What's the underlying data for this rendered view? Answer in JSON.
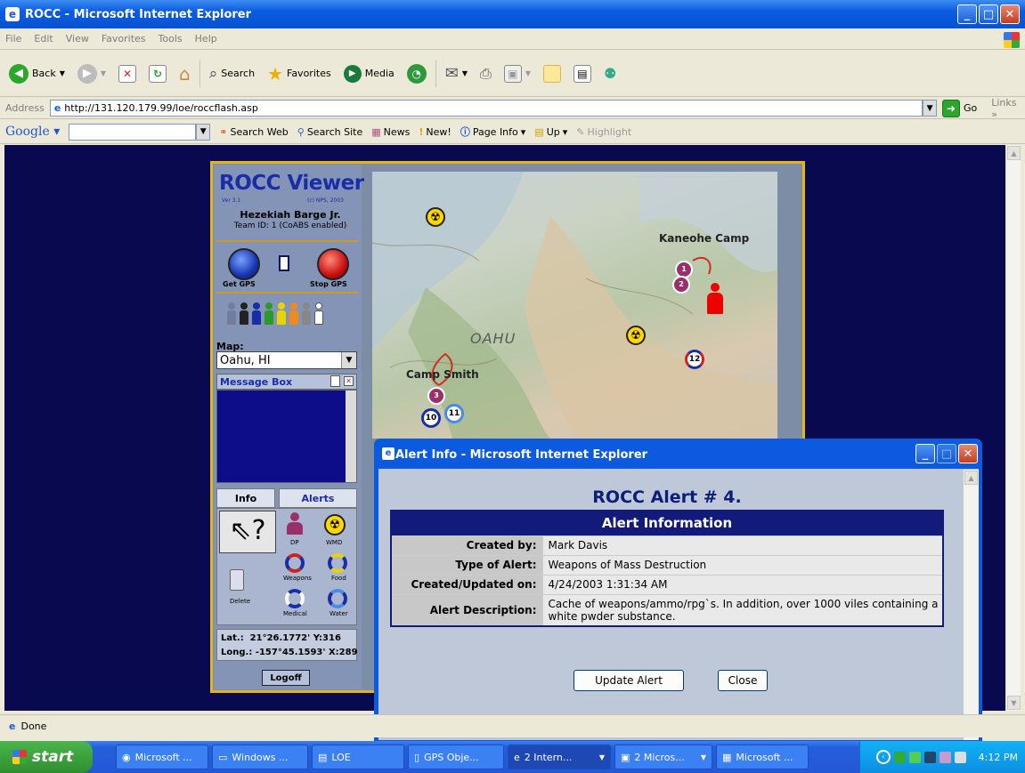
{
  "window": {
    "title": "ROCC - Microsoft Internet Explorer"
  },
  "menu": [
    "File",
    "Edit",
    "View",
    "Favorites",
    "Tools",
    "Help"
  ],
  "toolbar": {
    "back": "Back",
    "search": "Search",
    "favorites": "Favorites",
    "media": "Media"
  },
  "address": {
    "label": "Address",
    "url": "http://131.120.179.99/loe/roccflash.asp",
    "go": "Go",
    "links": "Links"
  },
  "google": {
    "brand": "Google",
    "items": [
      "Search Web",
      "Search Site",
      "News",
      "New!",
      "Page Info",
      "Up",
      "Highlight"
    ]
  },
  "viewer": {
    "logo": "ROCC Viewer",
    "version": "Ver 3.1",
    "copyright": "(c) NPS, 2003",
    "user": "Hezekiah Barge Jr.",
    "team": "Team ID: 1   (CoABS enabled)",
    "get_gps": "Get GPS",
    "stop_gps": "Stop GPS",
    "map_label": "Map:",
    "map_value": "Oahu, HI",
    "message_box": "Message Box",
    "tabs": {
      "info": "Info",
      "alerts": "Alerts"
    },
    "palette": {
      "dp": "DP",
      "wmd": "WMD",
      "weapons": "Weapons",
      "food": "Food",
      "delete": "Delete",
      "medical": "Medical",
      "water": "Water"
    },
    "lat_label": "Lat.:",
    "lat_value": "21°26.1772'",
    "y_label": "Y:316",
    "long_label": "Long.:",
    "long_value": "-157°45.1593'",
    "x_label": "X:289",
    "logoff": "Logoff"
  },
  "map": {
    "labels": {
      "kaneohe": "Kaneohe Camp",
      "oahu": "OAHU",
      "camp_smith": "Camp Smith"
    },
    "markers": [
      "1",
      "2",
      "3",
      "10",
      "11",
      "12"
    ]
  },
  "alert": {
    "window_title": "Alert Info - Microsoft Internet Explorer",
    "heading": "ROCC Alert # 4.",
    "table_header": "Alert Information",
    "rows": [
      {
        "key": "Created by:",
        "value": "Mark Davis"
      },
      {
        "key": "Type of Alert:",
        "value": "Weapons of Mass Destruction"
      },
      {
        "key": "Created/Updated on:",
        "value": "4/24/2003 1:31:34 AM"
      },
      {
        "key": "Alert Description:",
        "value": "Cache of weapons/ammo/rpg`s. In addition, over 1000 viles containing a white pwder substance."
      }
    ],
    "update_button": "Update Alert",
    "close_button": "Close"
  },
  "status": {
    "text": "Done"
  },
  "taskbar": {
    "start": "start",
    "tasks": [
      "Microsoft ...",
      "Windows ...",
      "LOE",
      "GPS Obje...",
      "2 Intern...",
      "2 Micros...",
      "Microsoft ..."
    ],
    "clock": "4:12 PM"
  },
  "colors": {
    "accent": "#0b5adf",
    "viewer_border": "#e2b51b",
    "alert_header": "#121a7a",
    "content_bg": "#09094f"
  }
}
